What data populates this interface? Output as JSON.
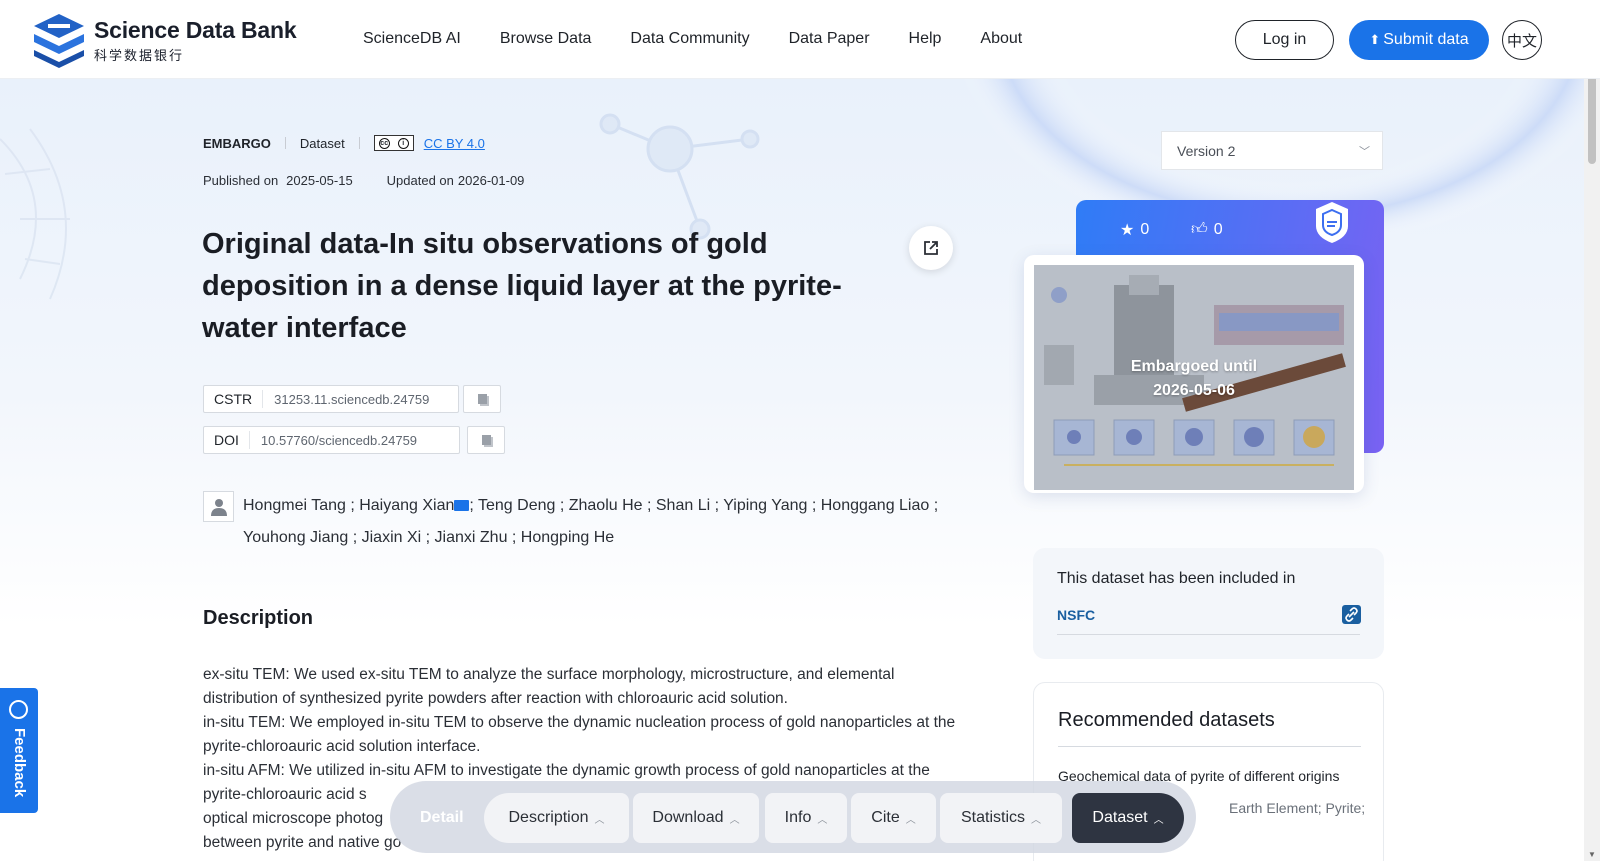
{
  "header": {
    "logo_en": "Science Data Bank",
    "logo_cn": "科学数据银行",
    "nav": [
      "ScienceDB AI",
      "Browse Data",
      "Data Community",
      "Data Paper",
      "Help",
      "About"
    ],
    "login_label": "Log in",
    "submit_label": "Submit data",
    "lang_label": "中文"
  },
  "meta": {
    "status": "EMBARGO",
    "type": "Dataset",
    "license": "CC BY 4.0",
    "published_label": "Published on",
    "published_date": "2025-05-15",
    "updated_label": "Updated on",
    "updated_date": "2026-01-09"
  },
  "dataset": {
    "title": "Original data-In situ observations of gold deposition in a dense liquid layer at the pyrite-water interface",
    "cstr_label": "CSTR",
    "cstr": "31253.11.sciencedb.24759",
    "doi_label": "DOI",
    "doi": "10.57760/sciencedb.24759",
    "authors_before_mail": "Hongmei Tang ; Haiyang Xian",
    "authors_after_mail": "; Teng Deng ; Zhaolu He ; Shan Li ; Yiping Yang ; Honggang Liao ; Youhong Jiang ; Jiaxin Xi ; Jianxi Zhu ; Hongping He"
  },
  "description": {
    "heading": "Description",
    "lines": [
      "ex-situ TEM: We used ex-situ TEM to analyze the surface morphology, microstructure, and elemental distribution of synthesized pyrite powders after reaction with chloroauric acid solution.",
      "in-situ TEM: We employed in-situ TEM to observe the dynamic nucleation process of gold nanoparticles at the pyrite-chloroauric acid solution interface.",
      "in-situ AFM: We utilized in-situ AFM to investigate the dynamic growth process of gold nanoparticles at the pyrite-chloroauric acid s",
      "optical microscope photog",
      "between pyrite and native go"
    ]
  },
  "sidebar": {
    "version": "Version 2",
    "stars": "0",
    "likes": "0",
    "embargo_line1": "Embargoed until",
    "embargo_line2": "2026-05-06",
    "included_title": "This dataset has been included in",
    "included_name": "NSFC",
    "recommended_title": "Recommended datasets",
    "recommended_item": "Geochemical data of pyrite of different origins",
    "recommended_keywords": "Earth Element; Pyrite;"
  },
  "feedback_label": "Feedback",
  "floatbar": {
    "detail": "Detail",
    "tabs": [
      "Description",
      "Download",
      "Info",
      "Cite",
      "Statistics",
      "Dataset"
    ]
  },
  "colors": {
    "primary": "#1a73e8",
    "dark_tab": "#2e3441",
    "link": "#1a5fa0"
  }
}
